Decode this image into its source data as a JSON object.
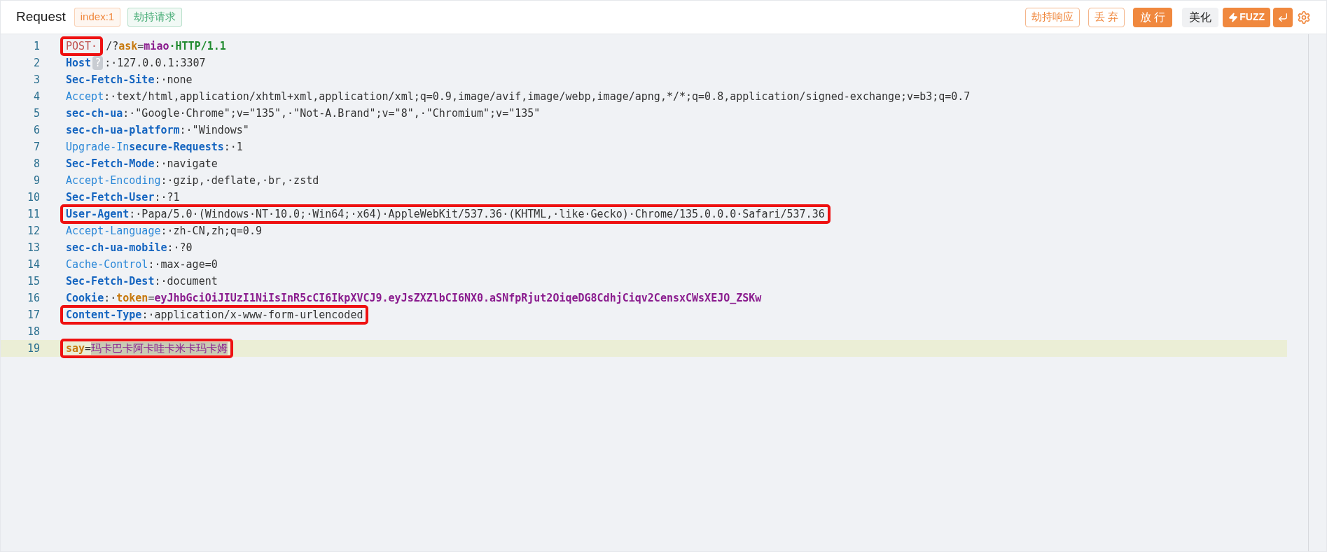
{
  "header": {
    "title": "Request",
    "tags": [
      {
        "text": "index:1",
        "color": "#f0883e"
      },
      {
        "text": "劫持请求",
        "color": "#4caf7a"
      }
    ],
    "buttons": [
      {
        "label": "劫持响应",
        "kind": "outline"
      },
      {
        "label": "丢 弃",
        "kind": "outline"
      },
      {
        "label": "放 行",
        "kind": "filled"
      },
      {
        "label": "美化",
        "kind": "plain"
      },
      {
        "label": "FUZZ",
        "kind": "fuzz"
      },
      {
        "kind": "enter"
      },
      {
        "kind": "settings"
      }
    ]
  },
  "editor": {
    "lines": [
      {
        "number": "1",
        "boxed": true,
        "active": false,
        "tokens": [
          {
            "kind": "method",
            "text": "POST·"
          },
          {
            "kind": "plain",
            "text": "/?",
            "boxed": false
          },
          {
            "kind": "pkey",
            "text": "ask",
            "boxed": false
          },
          {
            "kind": "plain",
            "text": "=",
            "boxed": false
          },
          {
            "kind": "pval",
            "text": "miao",
            "boxed": false
          },
          {
            "kind": "proto",
            "text": "·HTTP/1.1",
            "boxed": false
          }
        ]
      },
      {
        "number": "2",
        "boxed": false,
        "active": false,
        "tokens": [
          {
            "kind": "key",
            "text": "Host"
          },
          {
            "kind": "hint",
            "text": "?"
          },
          {
            "kind": "plain",
            "text": ":·127.0.0.1:3307"
          }
        ]
      },
      {
        "number": "3",
        "boxed": false,
        "active": false,
        "tokens": [
          {
            "kind": "key",
            "text": "Sec-Fetch-Site"
          },
          {
            "kind": "plain",
            "text": ":·none"
          }
        ]
      },
      {
        "number": "4",
        "boxed": false,
        "active": false,
        "tokens": [
          {
            "kind": "lkey",
            "text": "Accept"
          },
          {
            "kind": "plain",
            "text": ":·text/html,application/xhtml+xml,application/xml;q=0.9,image/avif,image/webp,image/apng,*/*;q=0.8,application/signed-exchange;v=b3;q=0.7"
          }
        ]
      },
      {
        "number": "5",
        "boxed": false,
        "active": false,
        "tokens": [
          {
            "kind": "key",
            "text": "sec-ch-ua"
          },
          {
            "kind": "plain",
            "text": ":·\"Google·Chrome\";v=\"135\",·\"Not-A.Brand\";v=\"8\",·\"Chromium\";v=\"135\""
          }
        ]
      },
      {
        "number": "6",
        "boxed": false,
        "active": false,
        "tokens": [
          {
            "kind": "key",
            "text": "sec-ch-ua-platform"
          },
          {
            "kind": "plain",
            "text": ":·\"Windows\""
          }
        ]
      },
      {
        "number": "7",
        "boxed": false,
        "active": false,
        "tokens": [
          {
            "kind": "lkey",
            "text": "Upgrade-In"
          },
          {
            "kind": "key",
            "text": "secure-Requests"
          },
          {
            "kind": "plain",
            "text": ":·1"
          }
        ]
      },
      {
        "number": "8",
        "boxed": false,
        "active": false,
        "tokens": [
          {
            "kind": "key",
            "text": "Sec-Fetch-Mode"
          },
          {
            "kind": "plain",
            "text": ":·navigate"
          }
        ]
      },
      {
        "number": "9",
        "boxed": false,
        "active": false,
        "tokens": [
          {
            "kind": "lkey",
            "text": "Accept-Encoding"
          },
          {
            "kind": "plain",
            "text": ":·gzip,·deflate,·br,·zstd"
          }
        ]
      },
      {
        "number": "10",
        "boxed": false,
        "active": false,
        "tokens": [
          {
            "kind": "key",
            "text": "Sec-Fetch-User"
          },
          {
            "kind": "plain",
            "text": ":·?1"
          }
        ]
      },
      {
        "number": "11",
        "boxed": true,
        "active": false,
        "tokens": [
          {
            "kind": "key",
            "text": "User-Agent"
          },
          {
            "kind": "plain",
            "text": ":·Papa/5.0·(Windows·NT·10.0;·Win64;·x64)·AppleWebKit/537.36·(KHTML,·like·Gecko)·Chrome/135.0.0.0·Safari/537.36"
          }
        ]
      },
      {
        "number": "12",
        "boxed": false,
        "active": false,
        "tokens": [
          {
            "kind": "lkey",
            "text": "Accept-Language"
          },
          {
            "kind": "plain",
            "text": ":·zh-CN,zh;q=0.9"
          }
        ]
      },
      {
        "number": "13",
        "boxed": false,
        "active": false,
        "tokens": [
          {
            "kind": "key",
            "text": "sec-ch-ua-mobile"
          },
          {
            "kind": "plain",
            "text": ":·?0"
          }
        ]
      },
      {
        "number": "14",
        "boxed": false,
        "active": false,
        "tokens": [
          {
            "kind": "lkey",
            "text": "Cache-Control"
          },
          {
            "kind": "plain",
            "text": ":·max-age=0"
          }
        ]
      },
      {
        "number": "15",
        "boxed": false,
        "active": false,
        "tokens": [
          {
            "kind": "key",
            "text": "Sec-Fetch-Dest"
          },
          {
            "kind": "plain",
            "text": ":·document"
          }
        ]
      },
      {
        "number": "16",
        "boxed": false,
        "active": false,
        "tokens": [
          {
            "kind": "key",
            "text": "Cookie"
          },
          {
            "kind": "plain",
            "text": ":·"
          },
          {
            "kind": "pkey",
            "text": "token"
          },
          {
            "kind": "plain",
            "text": "="
          },
          {
            "kind": "pval",
            "text": "eyJhbGciOiJIUzI1NiIsInR5cCI6IkpXVCJ9.eyJsZXZlbCI6NX0.aSNfpRjut2OiqeDG8CdhjCiqv2CensxCWsXEJO_ZSKw"
          }
        ]
      },
      {
        "number": "17",
        "boxed": true,
        "active": false,
        "tokens": [
          {
            "kind": "key",
            "text": "Content-Type"
          },
          {
            "kind": "plain",
            "text": ":·application/x-www-form-urlencoded"
          }
        ]
      },
      {
        "number": "18",
        "boxed": false,
        "active": false
      },
      {
        "number": "19",
        "boxed": true,
        "active": true,
        "tokens": [
          {
            "kind": "pkey",
            "text": "say"
          },
          {
            "kind": "plain",
            "text": "="
          },
          {
            "kind": "selval",
            "text": "玛卡巴卡阿卡哇卡米卡玛卡姆"
          }
        ]
      }
    ]
  }
}
